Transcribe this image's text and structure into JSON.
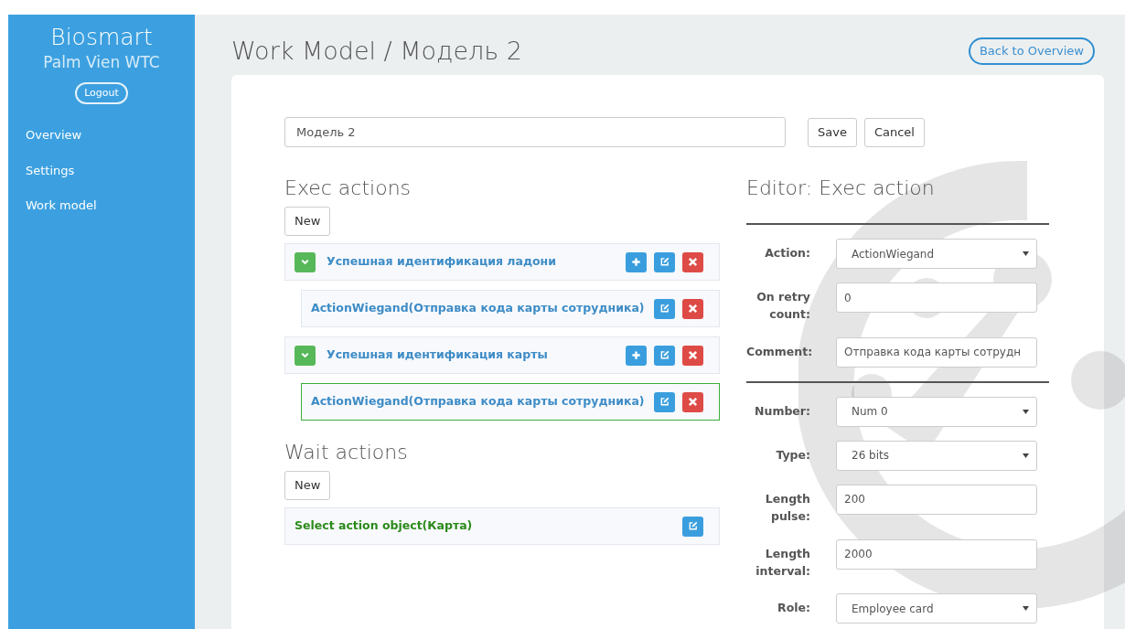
{
  "sidebar": {
    "brand": "Biosmart",
    "subtitle": "Palm Vien WTC",
    "logout": "Logout",
    "items": [
      {
        "label": "Overview"
      },
      {
        "label": "Settings"
      },
      {
        "label": "Work model"
      }
    ]
  },
  "header": {
    "title": "Work Model / Модель 2",
    "back": "Back to Overview"
  },
  "model_name": {
    "value": "Модель 2"
  },
  "buttons": [
    "Save",
    "Cancel"
  ],
  "exec_actions": {
    "title": "Exec actions",
    "new_button": "New",
    "items": [
      {
        "label": "Успешная идентификация ладони",
        "expanded": true,
        "selected": false,
        "children": [
          {
            "label": "ActionWiegand(Отправка кода карты сотрудника)",
            "selected": false
          }
        ]
      },
      {
        "label": "Успешная идентификация карты",
        "expanded": true,
        "selected": false,
        "children": [
          {
            "label": "ActionWiegand(Отправка кода карты сотрудника)",
            "selected": true
          }
        ]
      }
    ]
  },
  "wait_actions": {
    "title": "Wait actions",
    "new_button": "New",
    "items": [
      {
        "label": "Select action object(Карта)",
        "selected": false
      }
    ]
  },
  "editor": {
    "title": "Editor: Exec action",
    "sections": [
      [
        {
          "label": "Action:",
          "kind": "select",
          "value": "ActionWiegand"
        },
        {
          "label": "On retry count:",
          "kind": "input",
          "value": "0"
        },
        {
          "label": "Comment:",
          "kind": "input",
          "value": "Отправка кода карты сотрудн"
        }
      ],
      [
        {
          "label": "Number:",
          "kind": "select",
          "value": "Num 0"
        },
        {
          "label": "Type:",
          "kind": "select",
          "value": "26 bits"
        },
        {
          "label": "Length pulse:",
          "kind": "input",
          "value": "200"
        },
        {
          "label": "Length interval:",
          "kind": "input",
          "value": "2000"
        },
        {
          "label": "Role:",
          "kind": "select",
          "value": "Employee card"
        }
      ]
    ]
  }
}
